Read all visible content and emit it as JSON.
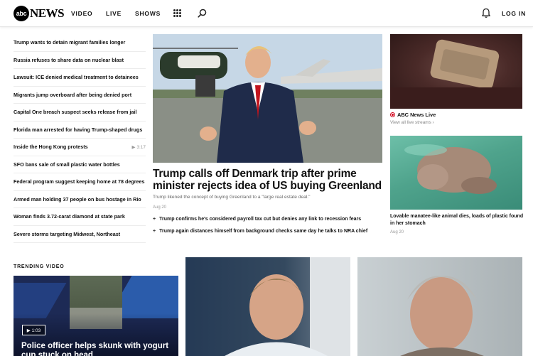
{
  "header": {
    "logo_small": "abc",
    "logo_word": "NEWS",
    "nav": [
      "VIDEO",
      "LIVE",
      "SHOWS"
    ],
    "login": "LOG IN",
    "icons": [
      "menu-grid-icon",
      "search-icon",
      "bell-icon"
    ]
  },
  "headlines": [
    {
      "text": "Trump wants to detain migrant families longer",
      "duration": ""
    },
    {
      "text": "Russia refuses to share data on nuclear blast",
      "duration": ""
    },
    {
      "text": "Lawsuit: ICE denied medical treatment to detainees",
      "duration": ""
    },
    {
      "text": "Migrants jump overboard after being denied port",
      "duration": ""
    },
    {
      "text": "Capital One breach suspect seeks release from jail",
      "duration": ""
    },
    {
      "text": "Florida man arrested for having Trump-shaped drugs",
      "duration": ""
    },
    {
      "text": "Inside the Hong Kong protests",
      "duration": "▶ 3:17"
    },
    {
      "text": "SFO bans sale of small plastic water bottles",
      "duration": ""
    },
    {
      "text": "Federal program suggest keeping home at 78 degrees",
      "duration": ""
    },
    {
      "text": "Armed man holding 37 people on bus hostage in Rio",
      "duration": ""
    },
    {
      "text": "Woman finds 3.72-carat diamond at state park",
      "duration": ""
    },
    {
      "text": "Severe storms targeting Midwest, Northeast",
      "duration": ""
    }
  ],
  "main_story": {
    "title": "Trump calls off Denmark trip after prime minister rejects idea of US buying Greenland",
    "subtitle": "Trump likened the concept of buying Greenland to a \"large real estate deal.\"",
    "date": "Aug 20",
    "related": [
      "Trump confirms he's considered payroll tax cut but denies any link to recession fears",
      "Trump again distances himself from background checks same day he talks to NRA chief"
    ]
  },
  "live": {
    "label": "ABC News Live",
    "link": "View all live streams ›",
    "accent": "#d0021b"
  },
  "side_story": {
    "title": "Lovable manatee-like animal dies, loads of plastic found in her stomach",
    "date": "Aug 20"
  },
  "trending": {
    "label": "TRENDING VIDEO",
    "duration": "▶ 1:03",
    "title": "Police officer helps skunk with yogurt cup stuck on head"
  }
}
